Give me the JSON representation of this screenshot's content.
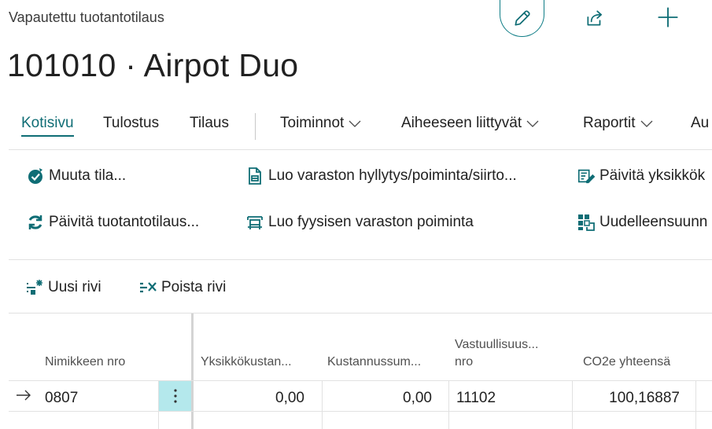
{
  "header": {
    "caption": "Vapautettu tuotantotilaus",
    "title": "101010 · Airpot Duo",
    "edit_icon": "pencil-icon",
    "share_icon": "share-icon",
    "add_icon": "plus-icon"
  },
  "tabs": [
    {
      "label": "Kotisivu",
      "active": true
    },
    {
      "label": "Tulostus"
    },
    {
      "label": "Tilaus"
    },
    {
      "label": "Toiminnot",
      "dropdown": true
    },
    {
      "label": "Aiheeseen liittyvät",
      "dropdown": true
    },
    {
      "label": "Raportit",
      "dropdown": true
    },
    {
      "label": "Au"
    }
  ],
  "actions": [
    {
      "label": "Muuta tila...",
      "icon": "change-status-icon"
    },
    {
      "label": "Luo varaston hyllytys/poiminta/siirto...",
      "icon": "warehouse-document-icon"
    },
    {
      "label": "Päivitä yksikkök",
      "icon": "update-unit-cost-icon"
    },
    {
      "label": "Päivitä tuotantotilaus...",
      "icon": "refresh-icon"
    },
    {
      "label": "Luo fyysisen varaston poiminta",
      "icon": "inventory-pick-icon"
    },
    {
      "label": "Uudelleensuunn",
      "icon": "replan-icon"
    }
  ],
  "lines_toolbar": {
    "new_line": "Uusi rivi",
    "delete_line": "Poista rivi"
  },
  "grid": {
    "columns": [
      "Nimikkeen nro",
      "Yksikkökustan...",
      "Kustannussum...",
      "Vastuullisuus... nro",
      "CO2e yhteensä"
    ],
    "column_2_line1": "Vastuullisuus...",
    "column_2_line2": "nro",
    "rows": [
      {
        "item_no": "0807",
        "unit_cost": "0,00",
        "cost_amount": "0,00",
        "sustainability_no": "11102",
        "co2e_total": "100,16887"
      }
    ]
  },
  "colors": {
    "accent": "#0f6d75",
    "selected_cell": "#b4e8ec",
    "divider": "#e1e1e1"
  }
}
